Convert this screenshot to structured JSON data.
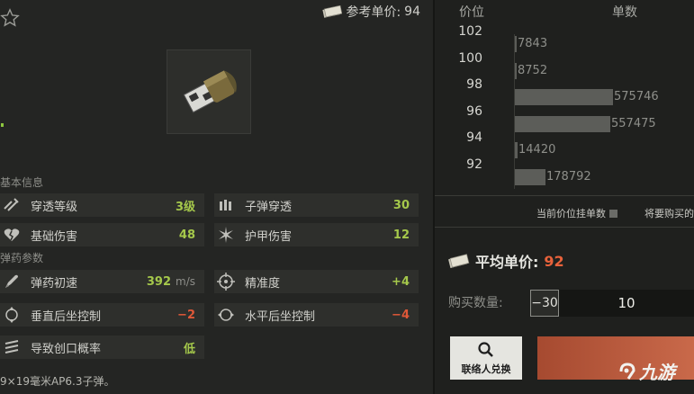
{
  "item": {
    "reference_price_label": "参考单价:",
    "reference_price": "94",
    "description": "9×19毫米AP6.3子弹。"
  },
  "sections": {
    "basic": "基本信息",
    "ammo": "弹药参数"
  },
  "stats": {
    "penetration_level": {
      "label": "穿透等级",
      "value": "3级",
      "icon": "penetration-icon"
    },
    "bullet_penetration": {
      "label": "子弹穿透",
      "value": "30",
      "icon": "bullets-icon"
    },
    "base_damage": {
      "label": "基础伤害",
      "value": "48",
      "icon": "broken-heart-icon"
    },
    "armor_damage": {
      "label": "护甲伤害",
      "value": "12",
      "icon": "armor-burst-icon"
    },
    "muzzle_velocity": {
      "label": "弹药初速",
      "value": "392",
      "unit": "m/s",
      "icon": "rocket-icon"
    },
    "accuracy": {
      "label": "精准度",
      "value": "+4",
      "icon": "crosshair-icon"
    },
    "vertical_recoil": {
      "label": "垂直后坐控制",
      "value": "−2",
      "icon": "vertical-recoil-icon"
    },
    "horizontal_recoil": {
      "label": "水平后坐控制",
      "value": "−4",
      "icon": "horizontal-recoil-icon"
    },
    "bleed_chance": {
      "label": "导致创口概率",
      "value": "低",
      "icon": "slash-wound-icon"
    }
  },
  "market": {
    "col_price": "价位",
    "col_count": "单数",
    "legend_current": "当前价位挂单数",
    "legend_buy": "将要购买的",
    "avg_label": "平均单价:",
    "avg_value": "92",
    "qty_label": "购买数量:",
    "qty_minus": "−30",
    "qty_value": "10",
    "contact_label": "联络人兑换"
  },
  "chart_data": {
    "type": "bar",
    "orientation": "horizontal",
    "xlabel": "单数",
    "ylabel": "价位",
    "categories": [
      "102",
      "100",
      "98",
      "96",
      "94",
      "92"
    ],
    "values": [
      7843,
      8752,
      575746,
      557475,
      14420,
      178792
    ],
    "xlim": [
      0,
      1000000
    ]
  },
  "watermark": {
    "text": "九游"
  },
  "colors": {
    "positive": "#a5c84b",
    "negative": "#e05838",
    "accent": "#e8623b",
    "buy_button": "#b8573a"
  }
}
